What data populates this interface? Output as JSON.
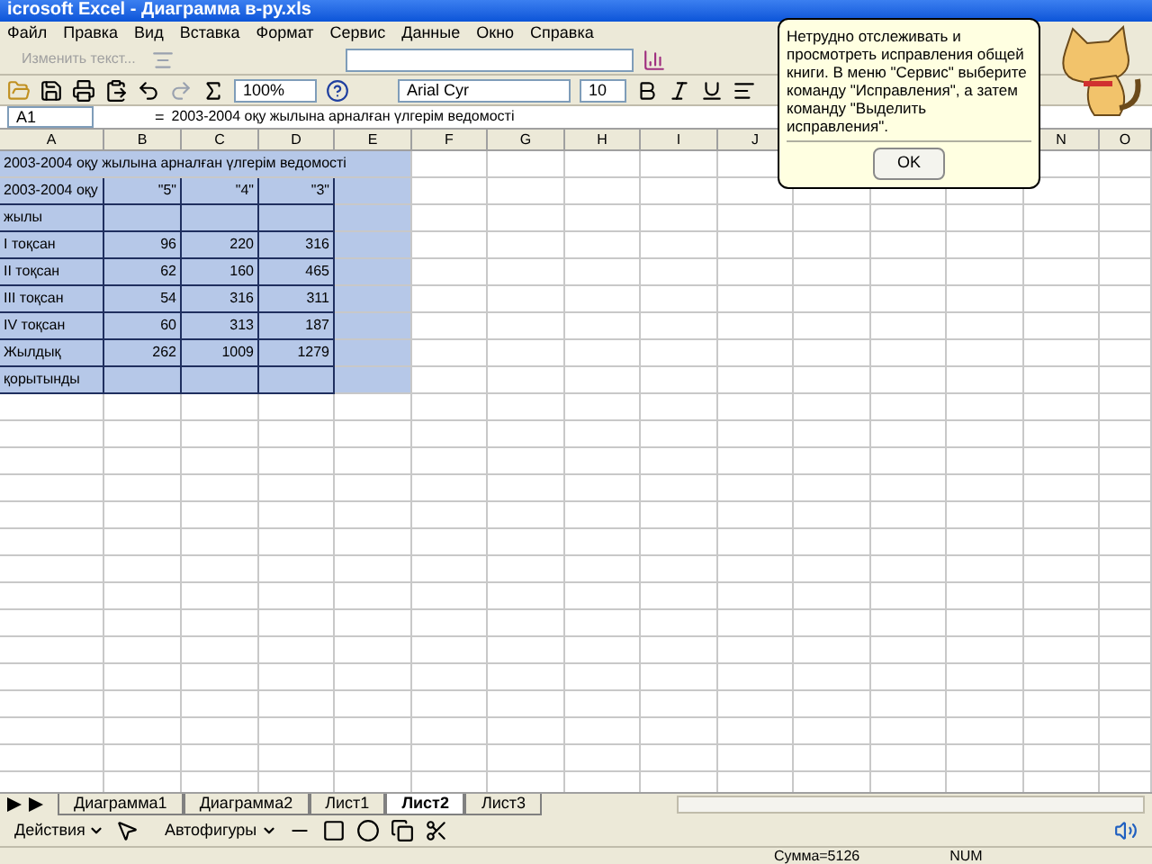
{
  "window": {
    "title": "icrosoft Excel - Диаграмма в-ру.xls"
  },
  "menu": [
    "Файл",
    "Правка",
    "Вид",
    "Вставка",
    "Формат",
    "Сервис",
    "Данные",
    "Окно",
    "Справка"
  ],
  "toolbar_top": {
    "edit_text": "Изменить текст...",
    "disabled": true
  },
  "toolbar_format": {
    "zoom": "100%",
    "font": "Arial Cyr",
    "size": "10"
  },
  "formula_bar": {
    "name_box": "A1",
    "equals": "=",
    "content": "2003-2004 оқу жылына арналған үлгерім ведомості"
  },
  "columns": [
    "A",
    "B",
    "C",
    "D",
    "E",
    "F",
    "G",
    "H",
    "I",
    "J",
    "N",
    "O"
  ],
  "rows": [
    {
      "kind": "title",
      "selected": true,
      "cells": [
        "2003-2004 оқу жылына арналған үлгерім ведомості"
      ]
    },
    {
      "kind": "data",
      "selected": true,
      "cells": [
        "2003-2004 оқу",
        "\"5\"",
        "\"4\"",
        "\"3\""
      ]
    },
    {
      "kind": "data",
      "selected": true,
      "cells": [
        "жылы"
      ]
    },
    {
      "kind": "data",
      "selected": true,
      "cells": [
        "I тоқсан",
        "96",
        "220",
        "316"
      ]
    },
    {
      "kind": "data",
      "selected": true,
      "cells": [
        "II тоқсан",
        "62",
        "160",
        "465"
      ]
    },
    {
      "kind": "data",
      "selected": true,
      "cells": [
        "III тоқсан",
        "54",
        "316",
        "311"
      ]
    },
    {
      "kind": "data",
      "selected": true,
      "cells": [
        "IV тоқсан",
        "60",
        "313",
        "187"
      ]
    },
    {
      "kind": "data",
      "selected": true,
      "cells": [
        "Жылдық",
        "262",
        "1009",
        "1279"
      ]
    },
    {
      "kind": "data",
      "selected": true,
      "cells": [
        "қорытынды"
      ]
    }
  ],
  "sheet_tabs": [
    {
      "label": "Диаграмма1",
      "selected": false
    },
    {
      "label": "Диаграмма2",
      "selected": false
    },
    {
      "label": "Лист1",
      "selected": false
    },
    {
      "label": "Лист2",
      "selected": true
    },
    {
      "label": "Лист3",
      "selected": false
    }
  ],
  "drawing_toolbar": {
    "actions": "Действия",
    "autoshapes": "Автофигуры"
  },
  "status_bar": {
    "sum": "Сумма=5126",
    "num": "NUM"
  },
  "assistant_balloon": {
    "text": "Нетрудно отслеживать и просмотреть исправления общей книги. В меню \"Сервис\" выберите команду \"Исправления\", а затем команду \"Выделить исправления\".",
    "button": "OK"
  }
}
